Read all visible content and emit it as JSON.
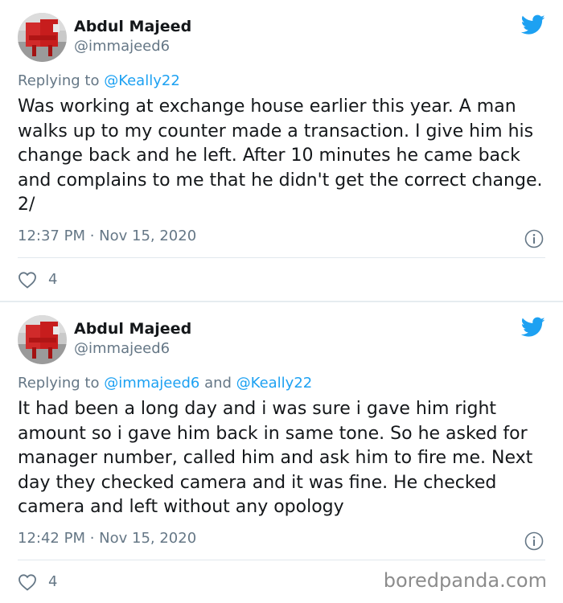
{
  "colors": {
    "accent": "#1da1f2",
    "text_primary": "#14171a",
    "text_secondary": "#657786",
    "divider": "#e1e8ed"
  },
  "tweets": [
    {
      "author_name": "Abdul Majeed",
      "author_handle": "@immajeed6",
      "reply_prefix": "Replying to ",
      "reply_mentions": "@Keally22",
      "body": "Was working at exchange house earlier this year. A man walks up to my counter made a transaction. I give him his change back and he left. After 10 minutes he came back and complains to me that he didn't get the correct change. 2/",
      "timestamp": "12:37 PM · Nov 15, 2020",
      "likes": "4",
      "icons": [
        "twitter-bird-icon",
        "info-icon",
        "heart-icon"
      ]
    },
    {
      "author_name": "Abdul Majeed",
      "author_handle": "@immajeed6",
      "reply_prefix": "Replying to ",
      "reply_mention_1": "@immajeed6",
      "reply_joiner": " and ",
      "reply_mention_2": "@Keally22",
      "body": "It had been a long day and i was sure i gave him right amount so i gave him back in same tone. So he asked for manager number, called him and ask him to fire me. Next day they checked camera and it was fine. He checked camera and left without any opology",
      "timestamp": "12:42 PM · Nov 15, 2020",
      "likes": "4",
      "icons": [
        "twitter-bird-icon",
        "info-icon",
        "heart-icon"
      ]
    }
  ],
  "watermark": "boredpanda.com"
}
